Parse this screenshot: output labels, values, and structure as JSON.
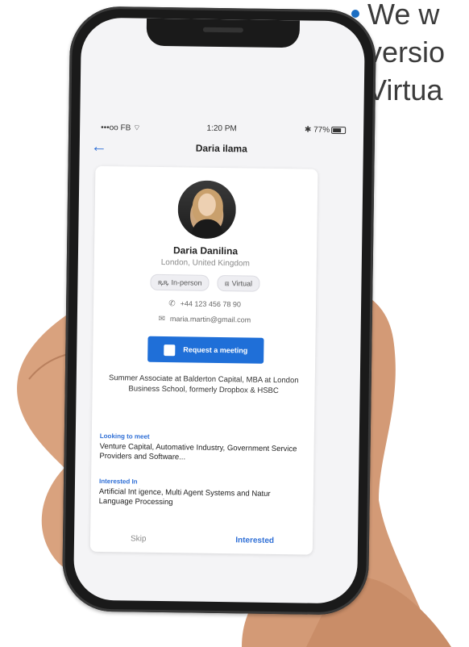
{
  "slide_text": {
    "lines": [
      "We w",
      "versio",
      "Virtua"
    ]
  },
  "status_bar": {
    "carrier": "•••oo FB",
    "time": "1:20 PM",
    "battery": "77%"
  },
  "nav": {
    "title": "Daria  ilama"
  },
  "profile": {
    "name": "Daria Danilina",
    "location": "London, United Kingdom",
    "tags": [
      {
        "icon": "people-icon",
        "label": "In-person"
      },
      {
        "icon": "video-icon",
        "label": "Virtual"
      }
    ],
    "phone": "+44 123 456 78 90",
    "email": "maria.martin@gmail.com",
    "request_button": "Request a meeting",
    "bio": "Summer Associate at Balderton Capital, MBA at London Business School, formerly Dropbox & HSBC",
    "looking_label": "Looking to meet",
    "looking_text": "Venture Capital, Automative Industry, Government Service Providers and Software...",
    "interested_label": "Interested In",
    "interested_text": "Artificial Int  igence, Multi Agent Systems and Natur  Language Processing",
    "skip_label": "Skip",
    "interested_button": "Interested"
  },
  "colors": {
    "accent": "#1f6fd8",
    "bullet": "#1c6ec2"
  }
}
